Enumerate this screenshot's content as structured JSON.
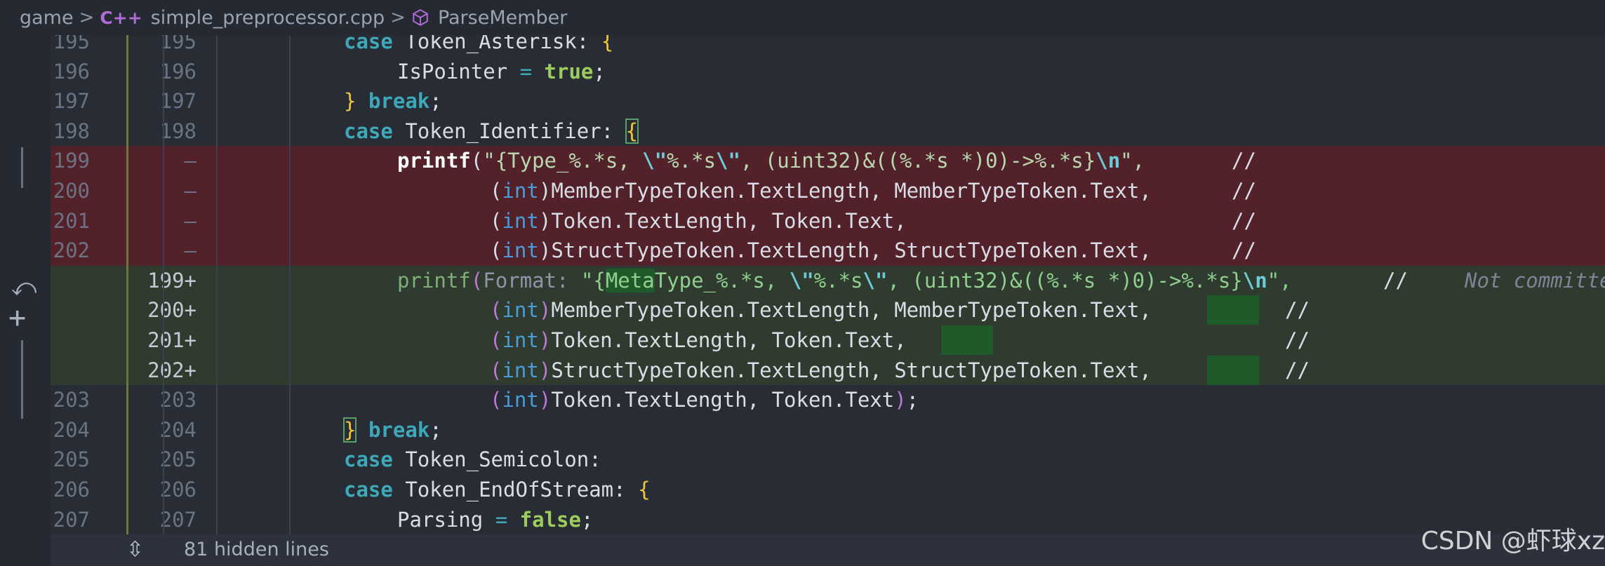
{
  "breadcrumb": {
    "folder": "game",
    "file": "simple_preprocessor.cpp",
    "file_icon": "cpp-icon",
    "symbol": "ParseMember",
    "symbol_icon": "method-cube-icon"
  },
  "lines": [
    {
      "old": "195",
      "new": "195",
      "type": "ctx"
    },
    {
      "old": "196",
      "new": "196",
      "type": "ctx"
    },
    {
      "old": "197",
      "new": "197",
      "type": "ctx"
    },
    {
      "old": "198",
      "new": "198",
      "type": "ctx"
    },
    {
      "old": "199",
      "new": "—",
      "type": "del"
    },
    {
      "old": "200",
      "new": "—",
      "type": "del"
    },
    {
      "old": "201",
      "new": "—",
      "type": "del"
    },
    {
      "old": "202",
      "new": "—",
      "type": "del"
    },
    {
      "old": "",
      "new": "199+",
      "type": "add"
    },
    {
      "old": "",
      "new": "200+",
      "type": "add"
    },
    {
      "old": "",
      "new": "201+",
      "type": "add"
    },
    {
      "old": "",
      "new": "202+",
      "type": "add"
    },
    {
      "old": "203",
      "new": "203",
      "type": "ctx"
    },
    {
      "old": "204",
      "new": "204",
      "type": "ctx"
    },
    {
      "old": "205",
      "new": "205",
      "type": "ctx"
    },
    {
      "old": "206",
      "new": "206",
      "type": "ctx"
    },
    {
      "old": "207",
      "new": "207",
      "type": "ctx"
    }
  ],
  "code": {
    "kw_case": "case",
    "kw_break": "break",
    "tok_asterisk": "Token_Asterisk:",
    "tok_identifier": "Token_Identifier:",
    "tok_semicolon": "Token_Semicolon:",
    "tok_eos": "Token_EndOfStream:",
    "is_pointer": "IsPointer",
    "parsing": "Parsing",
    "eq": "=",
    "semi": ";",
    "bool_true": "true",
    "bool_false": "false",
    "lbrace": "{",
    "rbrace": "}",
    "printf": "printf",
    "lparen": "(",
    "rparen": ")",
    "int": "int",
    "comment": "//",
    "del_fmt_a": "\"{Type_%.*s, ",
    "del_fmt_b": "\\\"",
    "del_fmt_c": "%.*s",
    "del_fmt_d": "\\\"",
    "del_fmt_e": ", (uint32)&((%.*s *)0)->%.*s}",
    "del_fmt_f": "\\n",
    "del_fmt_g": "\",",
    "member_args": "MemberTypeToken.TextLength, MemberTypeToken.Text,",
    "token_args": "Token.TextLength, Token.Text,",
    "struct_args": "StructTypeToken.TextLength, StructTypeToken.Text,",
    "token_args_last": "Token.TextLength, Token.Text",
    "param_hint": "Format:",
    "add_fmt_a": "\"{",
    "add_fmt_meta": "Meta",
    "add_fmt_b": "Type_%.*s, ",
    "add_fmt_c": "\\\"",
    "add_fmt_d": "%.*s",
    "add_fmt_e": "\\\"",
    "add_fmt_f": ", (uint32)&((%.*s *)0)->%.*s}",
    "add_fmt_g": "\\n",
    "add_fmt_h": "\",",
    "not_committed": "Not committed"
  },
  "hidden": {
    "label": "81 hidden lines",
    "icon": "unfold-icon"
  },
  "gutter_icons": [
    "revert-icon",
    "plus-icon"
  ],
  "watermark": "CSDN @虾球xz",
  "colors": {
    "deleted_bg": "#53212a",
    "added_bg": "#303b2f",
    "keyword": "#3fa8b8",
    "string": "#8fcf8f",
    "type": "#4a9cd6",
    "brace": "#f3c73a"
  }
}
